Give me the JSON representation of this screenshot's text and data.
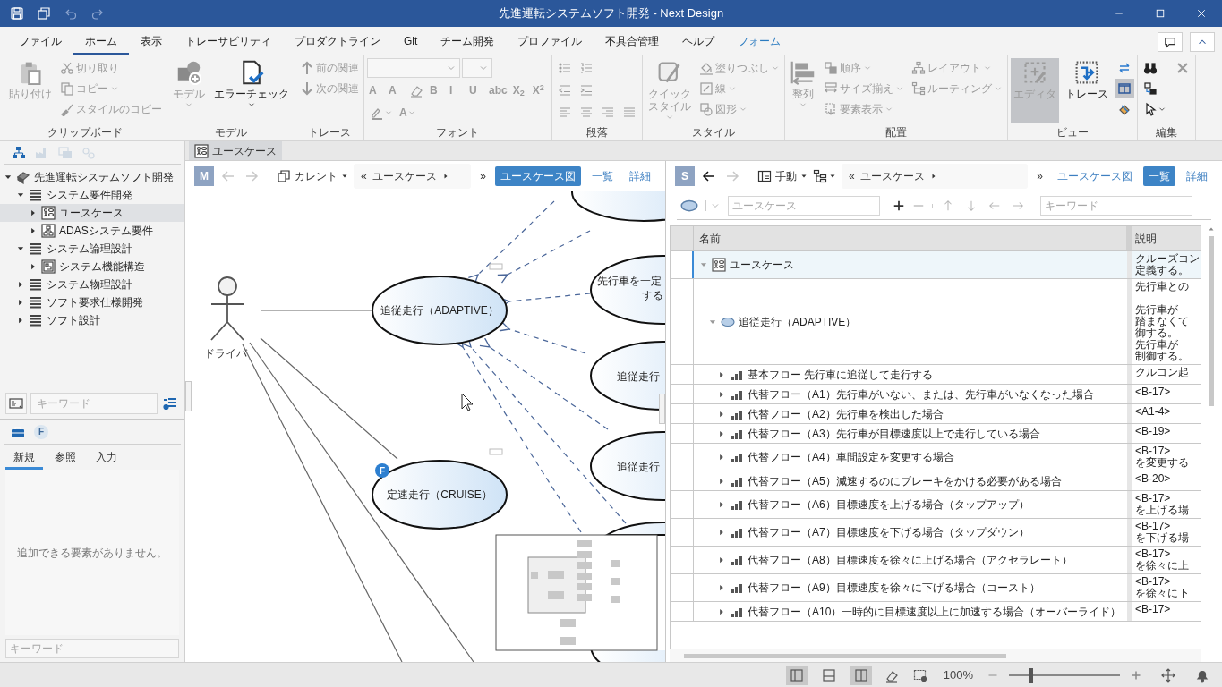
{
  "window": {
    "title": "先進運転システムソフト開発 - Next Design"
  },
  "quick_access": [
    {
      "disabled": false
    },
    {
      "disabled": false
    },
    {
      "disabled": true
    },
    {
      "disabled": true
    }
  ],
  "menu_tabs": [
    {
      "label": "ファイル",
      "selected": false
    },
    {
      "label": "ホーム",
      "selected": true
    },
    {
      "label": "表示",
      "selected": false
    },
    {
      "label": "トレーサビリティ",
      "selected": false
    },
    {
      "label": "プロダクトライン",
      "selected": false
    },
    {
      "label": "Git",
      "selected": false
    },
    {
      "label": "チーム開発",
      "selected": false
    },
    {
      "label": "プロファイル",
      "selected": false
    },
    {
      "label": "不具合管理",
      "selected": false
    },
    {
      "label": "ヘルプ",
      "selected": false
    },
    {
      "label": "フォーム",
      "selected": false,
      "contextual": true
    }
  ],
  "ribbon": {
    "groups": [
      {
        "label": "クリップボード",
        "columns": [
          {
            "items": [
              {
                "kind": "large",
                "label": "貼り付け",
                "disabled": true
              }
            ]
          },
          {
            "items": [
              {
                "kind": "small",
                "label": "切り取り",
                "disabled": true
              },
              {
                "kind": "small",
                "label": "コピー",
                "disabled": true,
                "dropdown": true
              },
              {
                "kind": "small",
                "label": "スタイルのコピー",
                "disabled": true
              }
            ]
          }
        ]
      },
      {
        "label": "モデル",
        "columns": [
          {
            "items": [
              {
                "kind": "large",
                "label": "モデル",
                "disabled": true,
                "dropdown": true
              }
            ]
          },
          {
            "items": [
              {
                "kind": "large",
                "label": "エラーチェック",
                "disabled": false,
                "dropdown": true
              }
            ]
          }
        ]
      },
      {
        "label": "トレース",
        "columns": [
          {
            "items": [
              {
                "kind": "small",
                "label": "前の関連",
                "disabled": true
              },
              {
                "kind": "small",
                "label": "次の関連",
                "disabled": true
              }
            ]
          }
        ]
      },
      {
        "label": "フォント",
        "rows": [
          {
            "items": [
              {
                "kind": "combo",
                "disabled": true
              },
              {
                "kind": "combo",
                "disabled": true
              }
            ]
          },
          {
            "items": [
              {
                "kind": "glyph",
                "label": "A",
                "disabled": true
              },
              {
                "kind": "glyph",
                "label": "A",
                "disabled": true
              },
              {
                "kind": "icon",
                "disabled": true
              },
              {
                "kind": "glyph",
                "label": "B",
                "disabled": true
              },
              {
                "kind": "glyph",
                "label": "I",
                "disabled": true
              },
              {
                "kind": "glyph",
                "label": "U",
                "disabled": true
              },
              {
                "kind": "glyph",
                "label": "abc",
                "disabled": true
              },
              {
                "kind": "glyph",
                "label": "X$_{2}$",
                "disabled": true
              },
              {
                "kind": "glyph",
                "label": "X$^{2}$",
                "disabled": true
              }
            ]
          },
          {
            "items": [
              {
                "kind": "icon",
                "disabled": true,
                "dropdown": true
              },
              {
                "kind": "glyph",
                "label": "A",
                "disabled": true,
                "dropdown": true
              }
            ]
          }
        ]
      },
      {
        "label": "段落",
        "rows": [
          {
            "items": [
              {
                "kind": "icon",
                "disabled": true
              },
              {
                "kind": "icon",
                "disabled": true
              }
            ]
          },
          {
            "items": [
              {
                "kind": "icon",
                "disabled": true
              },
              {
                "kind": "icon",
                "disabled": true
              }
            ]
          },
          {
            "items": [
              {
                "kind": "icon",
                "disabled": true
              },
              {
                "kind": "icon",
                "disabled": true
              },
              {
                "kind": "icon",
                "disabled": true
              },
              {
                "kind": "icon",
                "disabled": true
              }
            ]
          }
        ]
      },
      {
        "label": "スタイル",
        "columns": [
          {
            "items": [
              {
                "kind": "large",
                "label_lines": [
                  "クイック",
                  "スタイル"
                ],
                "disabled": true,
                "dropdown": true
              }
            ]
          },
          {
            "items": [
              {
                "kind": "small",
                "label": "塗りつぶし",
                "disabled": true,
                "dropdown": true
              },
              {
                "kind": "small",
                "label": "線",
                "disabled": true,
                "dropdown": true
              },
              {
                "kind": "small",
                "label": "図形",
                "disabled": true,
                "dropdown": true
              }
            ]
          }
        ]
      },
      {
        "label": "配置",
        "columns": [
          {
            "items": [
              {
                "kind": "large",
                "label": "整列",
                "disabled": true,
                "dropdown": true
              }
            ]
          },
          {
            "items": [
              {
                "kind": "small",
                "label": "順序",
                "disabled": true,
                "dropdown": true
              },
              {
                "kind": "small",
                "label": "サイズ揃え",
                "disabled": true,
                "dropdown": true
              },
              {
                "kind": "small",
                "label": "要素表示",
                "disabled": true,
                "dropdown": true
              }
            ]
          },
          {
            "items": [
              {
                "kind": "small",
                "label": "レイアウト",
                "disabled": true,
                "dropdown": true
              },
              {
                "kind": "small",
                "label": "ルーティング",
                "disabled": true,
                "dropdown": true
              }
            ]
          }
        ]
      },
      {
        "label": "ビュー",
        "columns": [
          {
            "items": [
              {
                "kind": "large",
                "label": "エディタ",
                "disabled": true,
                "selected": true
              }
            ]
          },
          {
            "items": [
              {
                "kind": "large",
                "label": "トレース",
                "disabled": false,
                "selected": false
              }
            ]
          },
          {
            "items": [
              {
                "kind": "icon",
                "selected": false
              },
              {
                "kind": "icon",
                "selected": true
              },
              {
                "kind": "icon",
                "selected": false
              }
            ]
          }
        ]
      },
      {
        "label": "編集",
        "columns": [
          {
            "items": [
              {
                "kind": "icon",
                "disabled": false
              },
              {
                "kind": "icon",
                "disabled": false
              },
              {
                "kind": "icon",
                "disabled": false,
                "dropdown": true
              }
            ]
          },
          {
            "items": [
              {
                "kind": "icon",
                "disabled": true
              }
            ]
          }
        ]
      }
    ]
  },
  "navigator": {
    "toolbar": [
      {
        "disabled": false
      },
      {
        "disabled": true
      },
      {
        "disabled": true
      },
      {
        "disabled": true
      }
    ],
    "tree": [
      {
        "label": "先進運転システムソフト開発",
        "kind": "project",
        "expanded": true,
        "selected": false,
        "children": [
          {
            "label": "システム要件開発",
            "kind": "folder",
            "expanded": true,
            "selected": false,
            "children": [
              {
                "label": "ユースケース",
                "kind": "usecase_diagram",
                "expanded": false,
                "selected": true
              },
              {
                "label": "ADASシステム要件",
                "kind": "block_diagram",
                "expanded": false,
                "selected": false
              }
            ]
          },
          {
            "label": "システム論理設計",
            "kind": "folder",
            "expanded": true,
            "selected": false,
            "children": [
              {
                "label": "システム機能構造",
                "kind": "structure_diagram",
                "expanded": false,
                "selected": false
              }
            ]
          },
          {
            "label": "システム物理設計",
            "kind": "folder",
            "expanded": false,
            "selected": false
          },
          {
            "label": "ソフト要求仕様開発",
            "kind": "folder",
            "expanded": false,
            "selected": false
          },
          {
            "label": "ソフト設計",
            "kind": "folder",
            "expanded": false,
            "selected": false
          }
        ]
      }
    ],
    "search": {
      "placeholder": "キーワード"
    }
  },
  "toolbox": {
    "filter_badge": "F",
    "tabs": [
      {
        "label": "新規",
        "selected": true
      },
      {
        "label": "参照",
        "selected": false
      },
      {
        "label": "入力",
        "selected": false
      }
    ],
    "empty_message": "追加できる要素がありません。",
    "search": {
      "placeholder": "キーワード"
    }
  },
  "document_tabs": [
    {
      "label": "ユースケース",
      "selected": true
    }
  ],
  "diagram_pane": {
    "badge": "M",
    "back_disabled": true,
    "forward_disabled": true,
    "scope": "カレント",
    "breadcrumb": {
      "prefix": "«",
      "label": "ユースケース",
      "more": "»"
    },
    "views": [
      {
        "label": "ユースケース図",
        "selected": true
      },
      {
        "label": "一覧",
        "selected": false
      },
      {
        "label": "詳細",
        "selected": false
      }
    ],
    "diagram": {
      "actors": [
        {
          "label": "ドライバ"
        }
      ],
      "use_cases": [
        {
          "kind": "use_case",
          "lines": [
            "追従走行（ADAPTIVE）"
          ]
        },
        {
          "kind": "use_case",
          "lines": [
            "定速走行（CRUISE）"
          ],
          "badge": "F"
        },
        {
          "kind": "use_case"
        },
        {
          "kind": "use_case",
          "lines": [
            "先行車を一定",
            "する"
          ]
        },
        {
          "kind": "use_case",
          "lines": [
            "追従走行"
          ]
        },
        {
          "kind": "use_case",
          "lines": [
            "追従走行"
          ]
        },
        {
          "kind": "use_case"
        },
        {
          "kind": "use_case"
        }
      ]
    }
  },
  "list_pane": {
    "badge": "S",
    "back_disabled": false,
    "forward_disabled": true,
    "mode": "手動",
    "breadcrumb": {
      "prefix": "«",
      "label": "ユースケース",
      "more": "»"
    },
    "views": [
      {
        "label": "ユースケース図",
        "selected": false
      },
      {
        "label": "一覧",
        "selected": true
      },
      {
        "label": "詳細",
        "selected": false
      }
    ],
    "class_field": {
      "placeholder": "ユースケース"
    },
    "add_disabled": false,
    "remove_disabled": true,
    "move_disabled": true,
    "search": {
      "placeholder": "キーワード"
    },
    "grid": {
      "columns": [
        "名前",
        "説明"
      ],
      "rows": [
        {
          "name": "ユースケース",
          "kind": "diagram",
          "expanded": true,
          "selected": true,
          "description": [
            [
              "クルーズコン",
              "定義する。"
            ]
          ],
          "children": [
            {
              "name": "追従走行（ADAPTIVE）",
              "kind": "usecase",
              "expanded": true,
              "selected": false,
              "description": [
                [
                  "先行車との"
                ],
                [
                  "先行車が",
                  "踏まなくて",
                  "御する。",
                  "先行車が",
                  "制御する。"
                ]
              ],
              "children": [
                {
                  "name": "基本フロー 先行車に追従して走行する",
                  "kind": "flow",
                  "expanded": false,
                  "selected": false,
                  "description": [
                    [
                      "クルコン起"
                    ]
                  ]
                },
                {
                  "name": "代替フロー（A1）先行車がいない、または、先行車がいなくなった場合",
                  "kind": "flow",
                  "expanded": false,
                  "selected": false,
                  "description": [
                    [
                      "<B-17>"
                    ]
                  ]
                },
                {
                  "name": "代替フロー（A2）先行車を検出した場合",
                  "kind": "flow",
                  "expanded": false,
                  "selected": false,
                  "description": [
                    [
                      "<A1-4>"
                    ]
                  ]
                },
                {
                  "name": "代替フロー（A3）先行車が目標速度以上で走行している場合",
                  "kind": "flow",
                  "expanded": false,
                  "selected": false,
                  "description": [
                    [
                      "<B-19>"
                    ]
                  ]
                },
                {
                  "name": "代替フロー（A4）車間設定を変更する場合",
                  "kind": "flow",
                  "expanded": false,
                  "selected": false,
                  "description": [
                    [
                      "<B-17>",
                      "を変更する"
                    ]
                  ]
                },
                {
                  "name": "代替フロー（A5）減速するのにブレーキをかける必要がある場合",
                  "kind": "flow",
                  "expanded": false,
                  "selected": false,
                  "description": [
                    [
                      "<B-20>"
                    ]
                  ]
                },
                {
                  "name": "代替フロー（A6）目標速度を上げる場合（タップアップ）",
                  "kind": "flow",
                  "expanded": false,
                  "selected": false,
                  "description": [
                    [
                      "<B-17>",
                      "を上げる場"
                    ]
                  ]
                },
                {
                  "name": "代替フロー（A7）目標速度を下げる場合（タップダウン）",
                  "kind": "flow",
                  "expanded": false,
                  "selected": false,
                  "description": [
                    [
                      "<B-17>",
                      "を下げる場"
                    ]
                  ]
                },
                {
                  "name": "代替フロー（A8）目標速度を徐々に上げる場合（アクセラレート）",
                  "kind": "flow",
                  "expanded": false,
                  "selected": false,
                  "description": [
                    [
                      "<B-17>",
                      "を徐々に上"
                    ]
                  ]
                },
                {
                  "name": "代替フロー（A9）目標速度を徐々に下げる場合（コースト）",
                  "kind": "flow",
                  "expanded": false,
                  "selected": false,
                  "description": [
                    [
                      "<B-17>",
                      "を徐々に下"
                    ]
                  ]
                },
                {
                  "name": "代替フロー（A10）一時的に目標速度以上に加速する場合（オーバーライド）",
                  "kind": "flow",
                  "expanded": false,
                  "selected": false,
                  "description": [
                    [
                      "<B-17>"
                    ]
                  ]
                }
              ]
            }
          ]
        }
      ]
    }
  },
  "status_bar": {
    "layout_buttons": [
      {
        "selected": true
      },
      {
        "selected": false
      },
      {
        "selected": true
      }
    ],
    "zoom": {
      "reading": "100%",
      "level": 0.18
    }
  }
}
